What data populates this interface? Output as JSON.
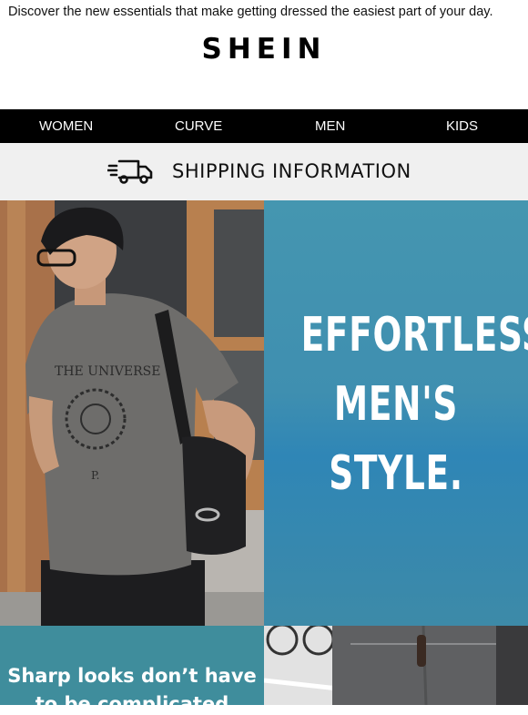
{
  "preheader": "Discover the new essentials that make getting dressed the easiest part of your day.",
  "brand": {
    "logo_text": "SHEIN"
  },
  "nav": {
    "items": [
      "WOMEN",
      "CURVE",
      "MEN",
      "KIDS"
    ]
  },
  "shipping": {
    "label": "SHIPPING INFORMATION",
    "icon": "delivery-truck-icon"
  },
  "hero": {
    "headline_lines": [
      "EFFORTLESS",
      "MEN'S",
      "STYLE."
    ],
    "photo_shirt_text": "THE UNIVERSE",
    "photo_shirt_initial": "P."
  },
  "promo": {
    "subtext_lines": [
      "Sharp looks don’t have",
      "to be complicated"
    ]
  },
  "colors": {
    "nav_bg": "#000000",
    "ship_bar_bg": "#f0f0f0",
    "hero_blue": "#3f8fb0",
    "promo_teal": "#3f8d9c"
  }
}
